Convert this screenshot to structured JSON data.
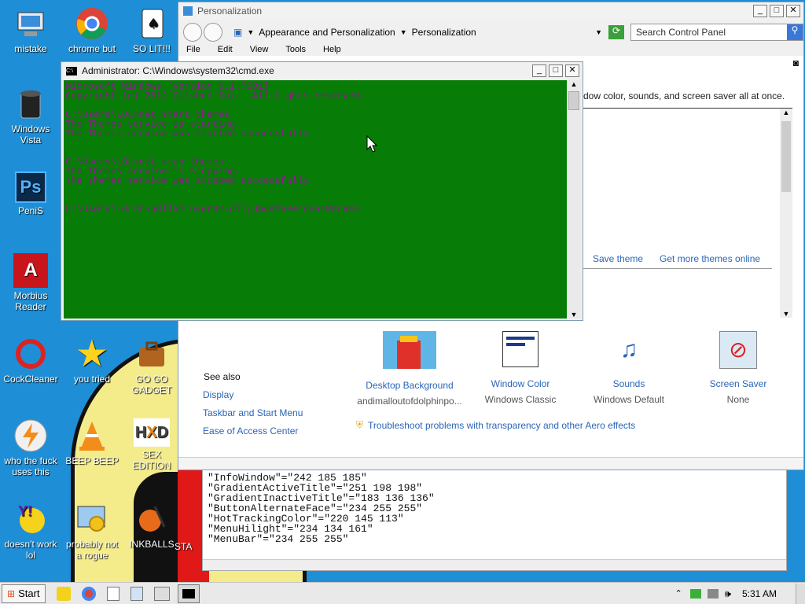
{
  "desktop": {
    "icons": [
      {
        "label": "mistake",
        "icon": "computer-icon"
      },
      {
        "label": "chrome but",
        "icon": "chrome-icon"
      },
      {
        "label": "SO LIT!!!",
        "icon": "cards-icon"
      },
      {
        "label": "Windows Vista",
        "icon": "recycle-bin-icon"
      },
      {
        "label": "PeniS",
        "icon": "photoshop-icon"
      },
      {
        "label": "Morbius Reader",
        "icon": "acrobat-icon"
      },
      {
        "label": "CockCleaner",
        "icon": "ccleaner-icon"
      },
      {
        "label": "you tried",
        "icon": "star-icon"
      },
      {
        "label": "GO GO GADGET",
        "icon": "briefcase-icon"
      },
      {
        "label": "who the fuck uses this",
        "icon": "winamp-icon"
      },
      {
        "label": "BEEP BEEP",
        "icon": "vlc-icon"
      },
      {
        "label": "SEX EDITION",
        "icon": "hxd-icon"
      },
      {
        "label": "doesn't work lol",
        "icon": "yahoo-icon"
      },
      {
        "label": "probably not a rogue",
        "icon": "gears-icon"
      },
      {
        "label": "INKBALLS",
        "icon": "inkball-icon"
      },
      {
        "label": "STA",
        "icon": "generic-icon"
      }
    ]
  },
  "personalization": {
    "title": "Personalization",
    "breadcrumb": [
      "Appearance and Personalization",
      "Personalization"
    ],
    "search_placeholder": "Search Control Panel",
    "menu": [
      "File",
      "Edit",
      "View",
      "Tools",
      "Help"
    ],
    "intro_text": "dow color, sounds, and screen saver all at once.",
    "save_theme": "Save theme",
    "get_more_themes": "Get more themes online",
    "see_also_title": "See also",
    "see_also_links": [
      "Display",
      "Taskbar and Start Menu",
      "Ease of Access Center"
    ],
    "items": [
      {
        "title": "Desktop Background",
        "value": "andimalloutofdolphinpo..."
      },
      {
        "title": "Window Color",
        "value": "Windows Classic"
      },
      {
        "title": "Sounds",
        "value": "Windows Default"
      },
      {
        "title": "Screen Saver",
        "value": "None"
      }
    ],
    "troubleshoot": "Troubleshoot problems with transparency and other Aero effects"
  },
  "cmd": {
    "title": "Administrator: C:\\Windows\\system32\\cmd.exe",
    "lines": [
      "Microsoft Windows [Version 6.1.7601]",
      "Copyright (c) 2012 Oilshed Sux.  All rights reserved.",
      "",
      "C:\\Users\\LOL>net start themes",
      "The Themes service is starting.",
      "The Themes service was started successfully.",
      "",
      "",
      "C:\\Users\\LOL>net stop themes",
      "The Themes service is stopping.",
      "The Themes service was stopped successfully.",
      "",
      "",
      "C:\\Users\\LOL>rundll32 user32.dll,UpdatePerUserParams"
    ]
  },
  "notepad": {
    "lines": [
      "\"InfoWindow\"=\"242 185 185\"",
      "\"GradientActiveTitle\"=\"251 198 198\"",
      "\"GradientInactiveTitle\"=\"183 136 136\"",
      "\"ButtonAlternateFace\"=\"234 255 255\"",
      "\"HotTrackingColor\"=\"220 145 113\"",
      "\"MenuHilight\"=\"234 134 161\"",
      "\"MenuBar\"=\"234 255 255\""
    ]
  },
  "taskbar": {
    "start_label": "Start",
    "clock": "5:31 AM"
  }
}
